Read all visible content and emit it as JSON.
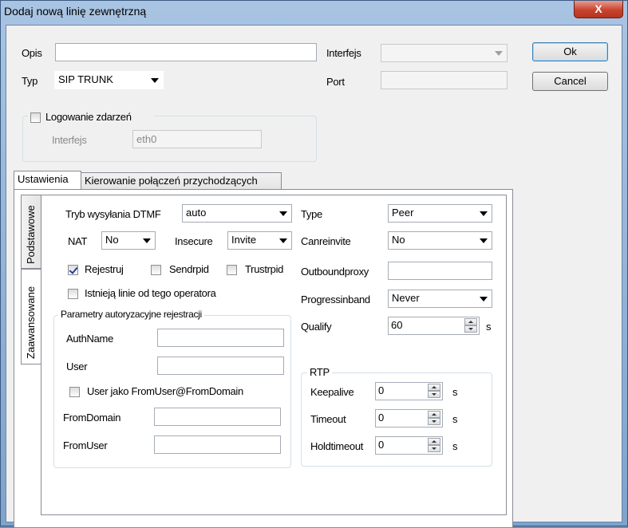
{
  "window": {
    "title": "Dodaj nową linię zewnętrzną",
    "close_glyph": "X"
  },
  "top": {
    "opis_label": "Opis",
    "opis_value": "",
    "typ_label": "Typ",
    "typ_value": "SIP TRUNK",
    "interfejs_label": "Interfejs",
    "interfejs_value": "",
    "port_label": "Port",
    "port_value": "",
    "ok_label": "Ok",
    "cancel_label": "Cancel"
  },
  "logging": {
    "checkbox_label": "Logowanie zdarzeń",
    "checked": false,
    "interfejs_label": "Interfejs",
    "interfejs_value": "eth0"
  },
  "tabs": [
    {
      "label": "Ustawienia",
      "active": true
    },
    {
      "label": "Kierowanie połączeń przychodzących",
      "active": false
    }
  ],
  "side_tabs": [
    {
      "label": "Podstawowe",
      "active": false
    },
    {
      "label": "Zaawansowane",
      "active": true
    }
  ],
  "left": {
    "dtmf_label": "Tryb wysyłania DTMF",
    "dtmf_value": "auto",
    "nat_label": "NAT",
    "nat_value": "No",
    "insecure_label": "Insecure",
    "insecure_value": "Invite",
    "rejestruj_label": "Rejestruj",
    "rejestruj_checked": true,
    "sendrpid_label": "Sendrpid",
    "sendrpid_checked": false,
    "trustrpid_label": "Trustrpid",
    "trustrpid_checked": false,
    "istnieja_label": "Istnieją linie od tego operatora",
    "istnieja_checked": false
  },
  "auth": {
    "group_label": "Parametry autoryzacyjne rejestracji",
    "authname_label": "AuthName",
    "authname_value": "",
    "user_label": "User",
    "user_value": "",
    "userjako_label": "User jako FromUser@FromDomain",
    "userjako_checked": false,
    "fromdomain_label": "FromDomain",
    "fromdomain_value": "",
    "fromuser_label": "FromUser",
    "fromuser_value": ""
  },
  "right": {
    "type_label": "Type",
    "type_value": "Peer",
    "canreinvite_label": "Canreinvite",
    "canreinvite_value": "No",
    "outboundproxy_label": "Outboundproxy",
    "outboundproxy_value": "",
    "progressinband_label": "Progressinband",
    "progressinband_value": "Never",
    "qualify_label": "Qualify",
    "qualify_value": "60",
    "qualify_unit": "s"
  },
  "rtp": {
    "group_label": "RTP",
    "keepalive_label": "Keepalive",
    "keepalive_value": "0",
    "keepalive_unit": "s",
    "timeout_label": "Timeout",
    "timeout_value": "0",
    "timeout_unit": "s",
    "holdtimeout_label": "Holdtimeout",
    "holdtimeout_value": "0",
    "holdtimeout_unit": "s"
  }
}
